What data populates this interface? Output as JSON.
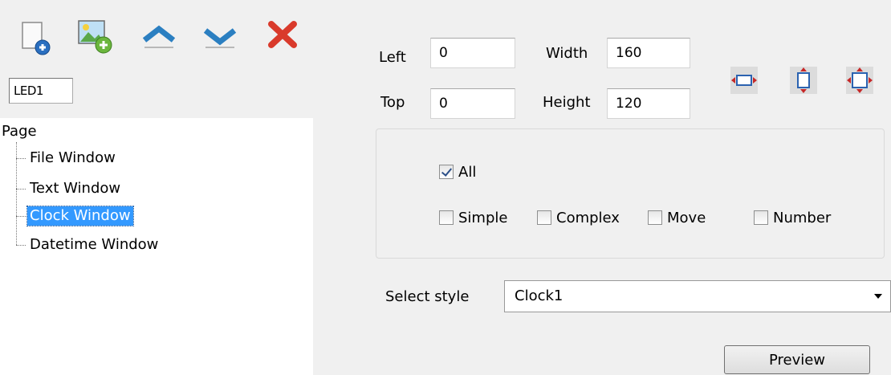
{
  "toolbar": {
    "icons": [
      "new-page-icon",
      "add-image-icon",
      "move-up-icon",
      "move-down-icon",
      "delete-icon"
    ]
  },
  "screen_name": "LED1",
  "tree": {
    "root": "Page",
    "items": [
      {
        "label": "File Window",
        "selected": false
      },
      {
        "label": "Text Window",
        "selected": false
      },
      {
        "label": "Clock Window",
        "selected": true
      },
      {
        "label": "Datetime Window",
        "selected": false
      }
    ]
  },
  "geometry_fields": {
    "left": {
      "label": "Left",
      "value": "0"
    },
    "top": {
      "label": "Top",
      "value": "0"
    },
    "width": {
      "label": "Width",
      "value": "160"
    },
    "height": {
      "label": "Height",
      "value": "120"
    }
  },
  "align_buttons": [
    "fit-width-icon",
    "fit-height-icon",
    "fit-both-icon"
  ],
  "options": {
    "all": {
      "label": "All",
      "checked": true
    },
    "simple": {
      "label": "Simple",
      "checked": false
    },
    "complex": {
      "label": "Complex",
      "checked": false
    },
    "move": {
      "label": "Move",
      "checked": false
    },
    "number": {
      "label": "Number",
      "checked": false
    }
  },
  "style_select": {
    "label": "Select style",
    "value": "Clock1"
  },
  "preview_button": {
    "label": "Preview"
  },
  "colors": {
    "selection": "#3399ff",
    "delete": "#d93a2b",
    "arrow": "#2b7fc1"
  }
}
